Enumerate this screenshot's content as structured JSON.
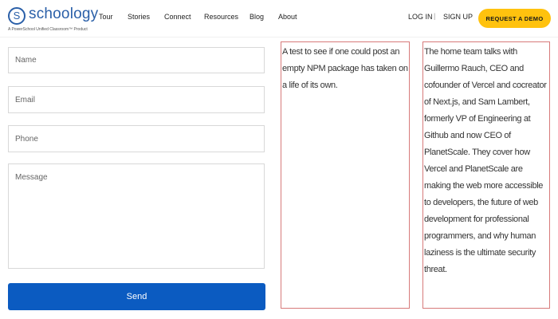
{
  "header": {
    "logo": {
      "name": "schoology",
      "tagline": "A PowerSchool Unified Classroom™ Product"
    },
    "nav": [
      "Tour",
      "Stories",
      "Connect",
      "Resources",
      "Blog",
      "About"
    ],
    "login": "LOG IN",
    "separator": "|",
    "signup": "SIGN UP",
    "demo_button": "REQUEST A DEMO"
  },
  "form": {
    "name_placeholder": "Name",
    "email_placeholder": "Email",
    "phone_placeholder": "Phone",
    "message_placeholder": "Message",
    "send_label": "Send"
  },
  "boxes": {
    "box1": "A test to see if one could post an empty NPM package has taken on a life of its own.",
    "box2": "The home team talks with Guillermo Rauch, CEO and cofounder of Vercel and cocreator of Next.js, and Sam Lambert, formerly VP of Engineering at Github and now CEO of PlanetScale. They cover how Vercel and PlanetScale are making the web more accessible to developers, the future of web development for professional programmers, and why human laziness is the ultimate security threat."
  },
  "colors": {
    "brand": "#2a5fa8",
    "demo_button": "#ffc20e",
    "send_button": "#0b5bc1",
    "box_border": "#d77a7a"
  }
}
